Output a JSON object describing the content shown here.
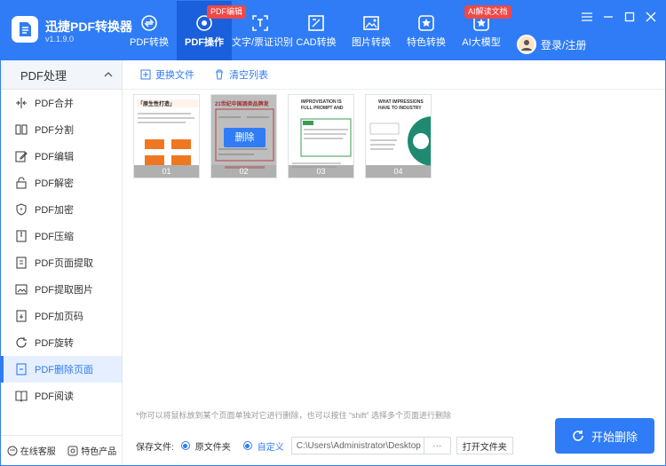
{
  "app": {
    "name": "迅捷PDF转换器",
    "version": "v1.1.9.0"
  },
  "nav": [
    {
      "label": "PDF转换",
      "icon": "pdf-convert-icon",
      "badge": ""
    },
    {
      "label": "PDF操作",
      "icon": "pdf-operate-icon",
      "badge": "PDF编辑",
      "active": true
    },
    {
      "label": "文字/票证识别",
      "icon": "ocr-icon",
      "badge": ""
    },
    {
      "label": "CAD转换",
      "icon": "cad-icon",
      "badge": ""
    },
    {
      "label": "图片转换",
      "icon": "image-icon",
      "badge": ""
    },
    {
      "label": "特色转换",
      "icon": "star-icon",
      "badge": ""
    },
    {
      "label": "AI大模型",
      "icon": "ai-icon",
      "badge": "AI解读文档"
    }
  ],
  "login": {
    "label": "登录/注册"
  },
  "sidebar": {
    "title": "PDF处理",
    "items": [
      {
        "label": "PDF合并"
      },
      {
        "label": "PDF分割"
      },
      {
        "label": "PDF编辑"
      },
      {
        "label": "PDF解密"
      },
      {
        "label": "PDF加密"
      },
      {
        "label": "PDF压缩"
      },
      {
        "label": "PDF页面提取"
      },
      {
        "label": "PDF提取图片"
      },
      {
        "label": "PDF加页码"
      },
      {
        "label": "PDF旋转"
      },
      {
        "label": "PDF删除页面",
        "active": true
      },
      {
        "label": "PDF阅读"
      }
    ],
    "footer": {
      "service": "在线客服",
      "products": "特色产品"
    }
  },
  "toolbar": {
    "replace": "更换文件",
    "clear": "清空列表"
  },
  "pages": [
    {
      "num": "01",
      "heading": "「原生性打造」"
    },
    {
      "num": "02",
      "heading": "21世纪中国酒类品牌发",
      "delete_label": "删除"
    },
    {
      "num": "03",
      "heading": "IMPROVISATION IS FULL PROMPT AND STIMULATE"
    },
    {
      "num": "04",
      "heading": "WHAT IMPRESSIONS HAVE TO INDUSTRY"
    }
  ],
  "hint": "*你可以将鼠标放到某个页面单独对它进行删除，也可以按住 “shift” 选择多个页面进行删除",
  "save": {
    "label": "保存文件:",
    "option_original": "原文件夹",
    "option_custom": "自定义",
    "path": "C:\\Users\\Administrator\\Desktop",
    "browse": "···",
    "open_folder": "打开文件夹"
  },
  "start_button": "开始删除",
  "colors": {
    "accent": "#2f7cf6",
    "badge": "#f04848"
  }
}
